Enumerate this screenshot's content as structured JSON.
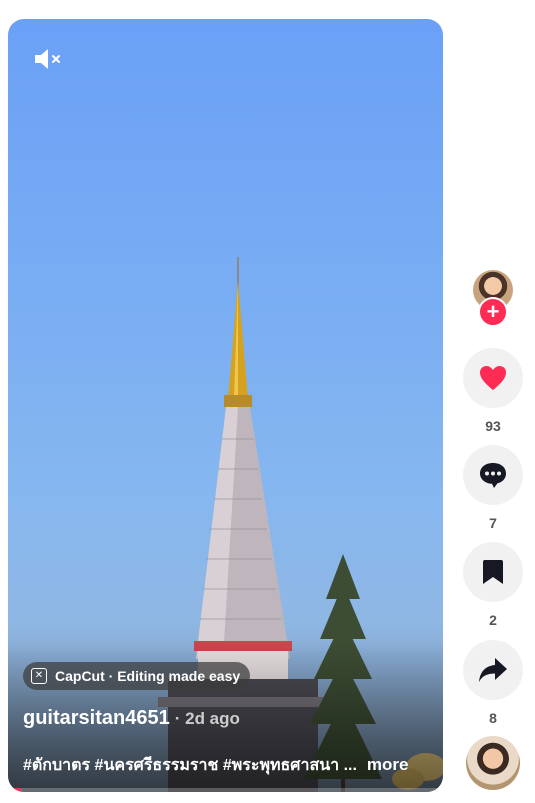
{
  "video": {
    "author": "guitarsitan4651",
    "time": "· 2d ago",
    "caption": "#ตักบาตร #นครศรีธรรมราช #พระพุทธศาสนา ...",
    "more_label": "more",
    "capcut_label": "CapCut · Editing made easy",
    "progress_fraction": 0.03,
    "accent_color": "#fe2c55"
  },
  "controls": {
    "mute_icon": "speaker-muted-icon"
  },
  "actions": {
    "follow_label": "+",
    "like_count": "93",
    "comment_count": "7",
    "bookmark_count": "2",
    "share_count": "8"
  }
}
